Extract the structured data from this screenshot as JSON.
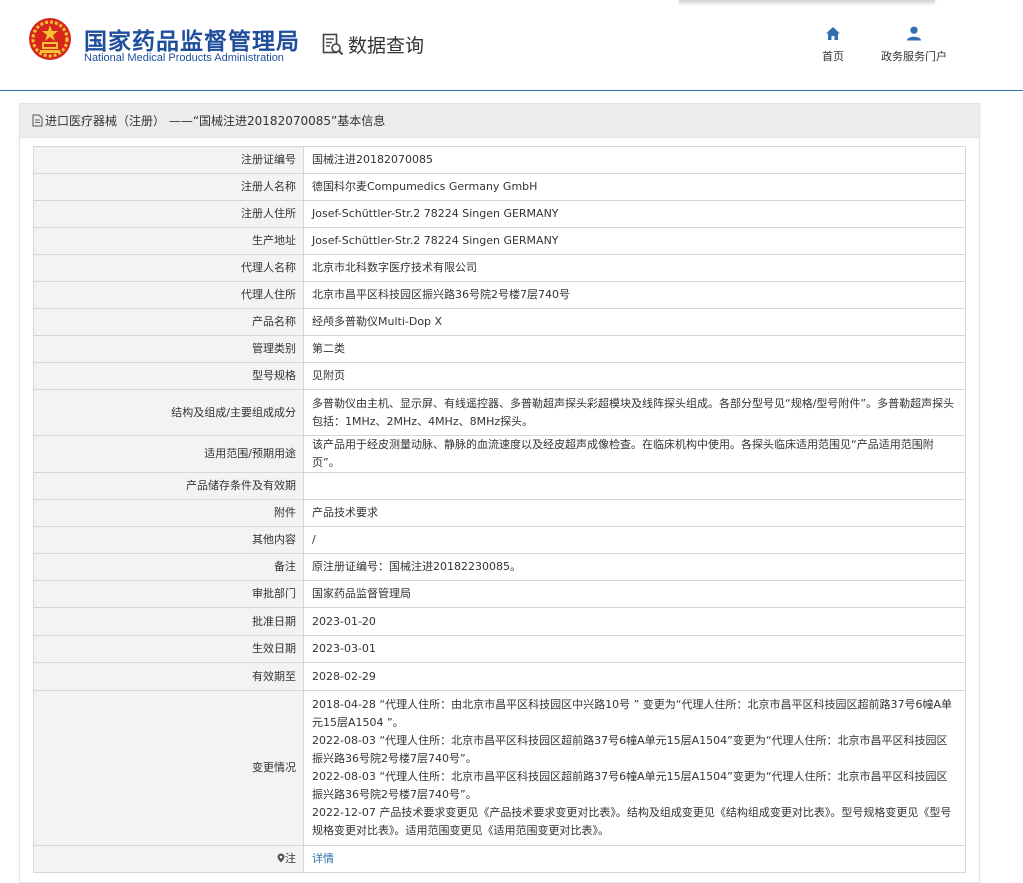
{
  "header": {
    "org_title": "国家药品监督管理局",
    "org_subtitle": "National Medical Products Administration",
    "section_title": "数据查询",
    "nav": {
      "home": "首页",
      "portal": "政务服务门户"
    }
  },
  "panel": {
    "title": "进口医疗器械（注册） ——“国械注进20182070085”基本信息"
  },
  "rows": {
    "reg_no": {
      "label": "注册证编号",
      "value": "国械注进20182070085"
    },
    "registrant": {
      "label": "注册人名称",
      "value": "德国科尔麦Compumedics Germany GmbH"
    },
    "registrant_address": {
      "label": "注册人住所",
      "value": "Josef-Schüttler-Str.2 78224 Singen GERMANY"
    },
    "production_address": {
      "label": "生产地址",
      "value": "Josef-Schüttler-Str.2 78224 Singen GERMANY"
    },
    "agent": {
      "label": "代理人名称",
      "value": "北京市北科数字医疗技术有限公司"
    },
    "agent_address": {
      "label": "代理人住所",
      "value": "北京市昌平区科技园区振兴路36号院2号楼7层740号"
    },
    "product_name": {
      "label": "产品名称",
      "value": "经颅多普勒仪Multi-Dop X"
    },
    "category": {
      "label": "管理类别",
      "value": "第二类"
    },
    "model": {
      "label": "型号规格",
      "value": "见附页"
    },
    "structure": {
      "label": "结构及组成/主要组成成分",
      "value": "多普勒仪由主机、显示屏、有线遥控器、多普勒超声探头彩超模块及线阵探头组成。各部分型号见“规格/型号附件”。多普勒超声探头包括：1MHz、2MHz、4MHz、8MHz探头。"
    },
    "scope": {
      "label": "适用范围/预期用途",
      "value": "该产品用于经皮测量动脉、静脉的血流速度以及经皮超声成像检查。在临床机构中使用。各探头临床适用范围见“产品适用范围附页”。"
    },
    "storage": {
      "label": "产品储存条件及有效期",
      "value": ""
    },
    "attachment": {
      "label": "附件",
      "value": "产品技术要求"
    },
    "other": {
      "label": "其他内容",
      "value": "/"
    },
    "remark": {
      "label": "备注",
      "value": "原注册证编号：国械注进20182230085。"
    },
    "approval_dept": {
      "label": "审批部门",
      "value": "国家药品监督管理局"
    },
    "approval_date": {
      "label": "批准日期",
      "value": "2023-01-20"
    },
    "effective_date": {
      "label": "生效日期",
      "value": "2023-03-01"
    },
    "expiry_date": {
      "label": "有效期至",
      "value": "2028-02-29"
    },
    "changes": {
      "label": "变更情况",
      "items": [
        "2018-04-28 “代理人住所：由北京市昌平区科技园区中兴路10号 ” 变更为“代理人住所：北京市昌平区科技园区超前路37号6幢A单元15层A1504 ”。",
        "2022-08-03 “代理人住所：北京市昌平区科技园区超前路37号6幢A单元15层A1504”变更为“代理人住所：北京市昌平区科技园区振兴路36号院2号楼7层740号”。",
        "2022-08-03 “代理人住所：北京市昌平区科技园区超前路37号6幢A单元15层A1504”变更为“代理人住所：北京市昌平区科技园区振兴路36号院2号楼7层740号”。",
        "2022-12-07 产品技术要求变更见《产品技术要求变更对比表》。结构及组成变更见《结构组成变更对比表》。型号规格变更见《型号规格变更对比表》。适用范围变更见《适用范围变更对比表》。"
      ]
    },
    "note": {
      "label": "注",
      "value": "详情"
    }
  },
  "colors": {
    "brand_blue": "#1f4f9c",
    "link_blue": "#2f6fb1",
    "label_bg": "#f3f3f3",
    "header_bar_bg": "#ececec"
  },
  "icons": {
    "emblem": "national-emblem-icon",
    "query": "search-document-icon",
    "home": "home-icon",
    "portal": "user-icon",
    "doc": "document-icon",
    "note": "pin-icon"
  }
}
